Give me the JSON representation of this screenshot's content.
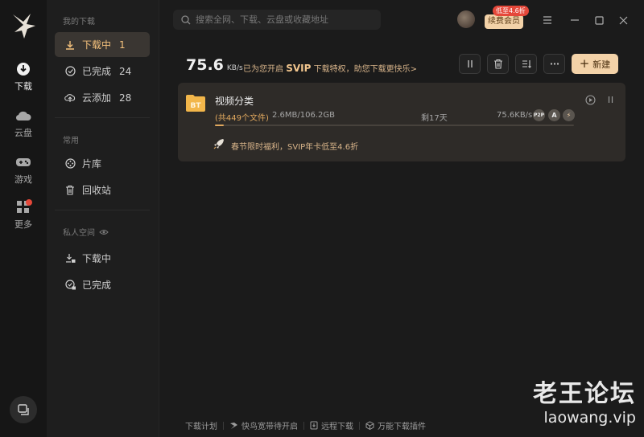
{
  "colors": {
    "accent": "#f3d2a8",
    "accent_text": "#f5c27d",
    "progress": "#e0a85e",
    "badge_red": "#e5483a"
  },
  "rail": {
    "items": [
      {
        "label": "下载",
        "icon": "download-icon",
        "active": true
      },
      {
        "label": "云盘",
        "icon": "cloud-icon",
        "active": false
      },
      {
        "label": "游戏",
        "icon": "gamepad-icon",
        "active": false
      },
      {
        "label": "更多",
        "icon": "grid-icon",
        "active": false
      }
    ],
    "bottom_icon": "switch-window-icon"
  },
  "sidebar": {
    "my_downloads_header": "我的下载",
    "downloading": {
      "label": "下载中",
      "count": "1"
    },
    "completed": {
      "label": "已完成",
      "count": "24"
    },
    "cloud_added": {
      "label": "云添加",
      "count": "28"
    },
    "common_header": "常用",
    "library": {
      "label": "片库"
    },
    "recycle": {
      "label": "回收站"
    },
    "private_header": "私人空间",
    "private_downloading": {
      "label": "下载中"
    },
    "private_completed": {
      "label": "已完成"
    }
  },
  "header": {
    "search_placeholder": "搜索全网、下载、云盘或收藏地址",
    "vip_badge": "低至4.6折",
    "vip_button": "续费会员"
  },
  "toolbar": {
    "speed_value": "75.6",
    "speed_unit": "KB/s",
    "promo_prefix": "已为您开启",
    "promo_svip": "SVIP",
    "promo_suffix": "下载特权，助您下载更快乐>",
    "new_label": "新建"
  },
  "task": {
    "name": "视频分类",
    "files": "(共449个文件)",
    "size": "2.6MB/106.2GB",
    "remaining": "剩17天",
    "rate": "75.6KB/s",
    "progress": 0.025,
    "tags": [
      "P2P",
      "A",
      "⚡"
    ],
    "promo": "春节限时福利，SVIP年卡低至4.6折"
  },
  "footer": {
    "plan": "下载计划",
    "broadband": "快鸟宽带待开启",
    "remote": "远程下载",
    "plugins": "万能下载插件"
  },
  "watermark": {
    "title": "老王论坛",
    "url": "laowang.vip"
  }
}
